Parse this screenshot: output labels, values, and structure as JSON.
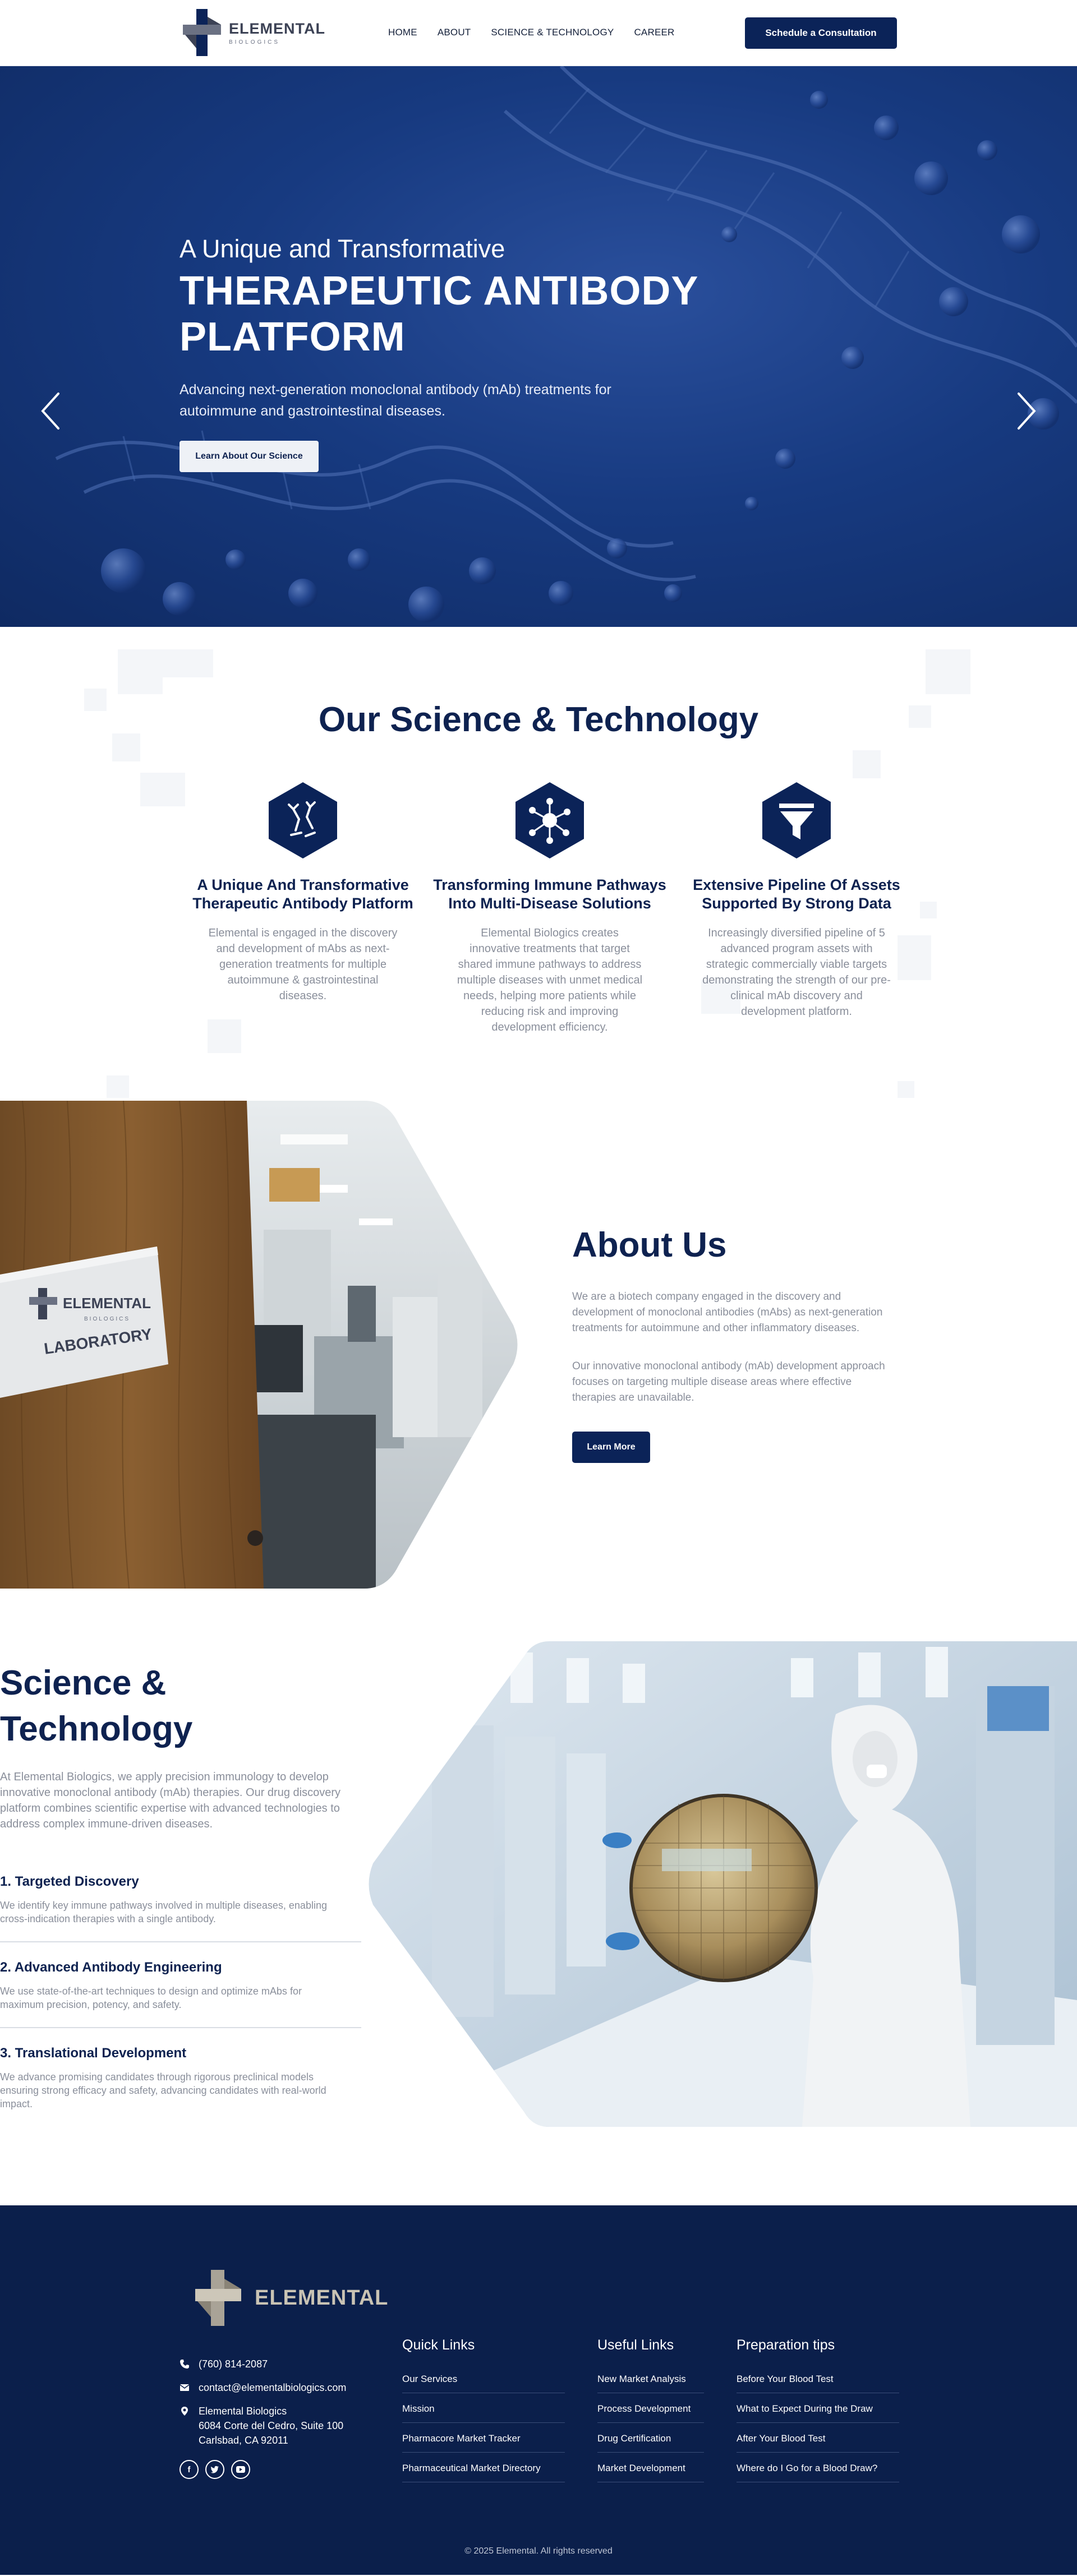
{
  "header": {
    "logo_title": "ELEMENTAL",
    "logo_sub": "BIOLOGICS",
    "nav": [
      "HOME",
      "ABOUT",
      "SCIENCE & TECHNOLOGY",
      "CAREER"
    ],
    "cta": "Schedule a Consultation"
  },
  "hero": {
    "pre_title": "A Unique and Transformative",
    "title_line1": "THERAPEUTIC ANTIBODY",
    "title_line2": "PLATFORM",
    "subtitle": "Advancing next-generation monoclonal antibody (mAb) treatments for autoimmune and gastrointestinal diseases.",
    "button": "Learn About Our Science",
    "slides_total": 3,
    "slide_active": 1
  },
  "science": {
    "title": "Our Science & Technology",
    "cards": [
      {
        "icon": "antibody-icon",
        "title": "A Unique And Transformative Therapeutic Antibody Platform",
        "text": "Elemental is engaged in the discovery and development of mAbs as next-generation treatments for multiple autoimmune & gastrointestinal diseases."
      },
      {
        "icon": "network-icon",
        "title": "Transforming Immune Pathways Into Multi-Disease Solutions",
        "text": "Elemental Biologics creates innovative treatments that target shared immune pathways to address multiple diseases with unmet medical needs, helping more patients while reducing risk and improving development efficiency."
      },
      {
        "icon": "funnel-icon",
        "title": "Extensive Pipeline Of Assets Supported By Strong Data",
        "text": "Increasingly diversified pipeline of 5 advanced program assets with strategic commercially viable targets demonstrating the strength of our pre-clinical mAb discovery and development platform."
      }
    ]
  },
  "about": {
    "sign_brand": "ELEMENTAL",
    "sign_sub": "BIOLOGICS",
    "sign_label": "LABORATORY",
    "title": "About Us",
    "p1": "We are a biotech company engaged in the discovery and development of monoclonal antibodies (mAbs) as next-generation treatments for autoimmune and other inflammatory diseases.",
    "p2": "Our innovative monoclonal antibody (mAb) development approach focuses on targeting multiple disease areas where effective therapies are unavailable.",
    "button": "Learn More"
  },
  "scitech": {
    "title_line1": "Science &",
    "title_line2": "Technology",
    "intro": "At Elemental Biologics, we apply precision immunology to develop innovative monoclonal antibody (mAb) therapies. Our drug discovery platform combines scientific expertise with advanced technologies to address complex immune-driven diseases.",
    "items": [
      {
        "title": "1. Targeted  Discovery",
        "text": "We identify key immune pathways involved in multiple diseases, enabling cross-indication therapies with a single antibody."
      },
      {
        "title": "2. Advanced Antibody Engineering",
        "text": "We use state-of-the-art techniques to design and optimize mAbs for maximum precision, potency, and safety."
      },
      {
        "title": "3. Translational Development",
        "text": "We advance promising candidates through rigorous preclinical models ensuring strong efficacy and safety, advancing candidates with real-world impact."
      }
    ]
  },
  "footer": {
    "logo_title": "ELEMENTAL",
    "phone": "(760) 814-2087",
    "email": "contact@elementalbiologics.com",
    "address_name": "Elemental Biologics",
    "address_line1": "6084 Corte del Cedro, Suite 100",
    "address_line2": "Carlsbad, CA 92011",
    "socials": [
      "facebook-icon",
      "twitter-icon",
      "youtube-icon"
    ],
    "quick_links_title": "Quick Links",
    "quick_links": [
      "Our Services",
      "Mission",
      "Pharmacore Market Tracker",
      "Pharmaceutical Market Directory"
    ],
    "useful_links_title": "Useful Links",
    "useful_links": [
      "New Market Analysis",
      "Process Development",
      "Drug Certification",
      "Market Development"
    ],
    "prep_title": "Preparation tips",
    "prep_links": [
      "Before Your Blood Test",
      "What to Expect During the Draw",
      "After Your Blood Test",
      "Where do I Go for a Blood Draw?"
    ],
    "copyright": "© 2025 Elemental. All rights reserved"
  },
  "colors": {
    "navy": "#0b2358",
    "footer_bg": "#0b1f4b",
    "hero_blue": "#173a80",
    "muted_text": "#8a8f9b"
  }
}
